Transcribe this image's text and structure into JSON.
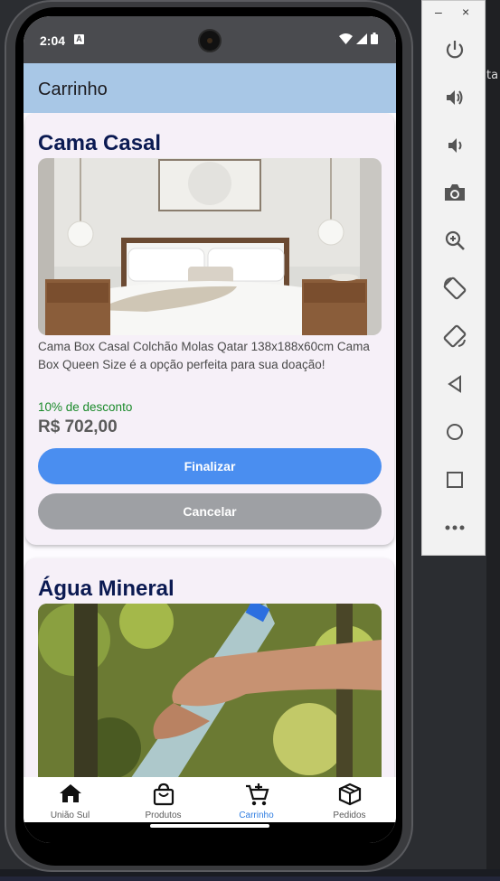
{
  "status_bar": {
    "time": "2:04",
    "notif_badge": "A"
  },
  "app_bar": {
    "title": "Carrinho"
  },
  "cart_items": [
    {
      "name": "Cama Casal",
      "image": "bedroom-photo",
      "description": "Cama Box Casal Colchão Molas Qatar 138x188x60cm Cama Box Queen Size é a opção perfeita para sua doação!",
      "discount": "10% de desconto",
      "price": "R$ 702,00",
      "finalize_label": "Finalizar",
      "cancel_label": "Cancelar"
    },
    {
      "name": "Água Mineral",
      "image": "water-bottle-photo"
    }
  ],
  "bottom_nav": [
    {
      "label": "União Sul",
      "icon": "home-icon",
      "active": false
    },
    {
      "label": "Produtos",
      "icon": "shopping-bag-icon",
      "active": false
    },
    {
      "label": "Carrinho",
      "icon": "cart-add-icon",
      "active": true
    },
    {
      "label": "Pedidos",
      "icon": "package-icon",
      "active": false
    }
  ],
  "emulator_toolbar": {
    "window_controls": [
      "–",
      "×"
    ],
    "buttons": [
      "power-icon",
      "volume-up-icon",
      "volume-down-icon",
      "camera-icon",
      "zoom-icon",
      "rotate-left-icon",
      "rotate-right-icon",
      "back-icon",
      "home-circle-icon",
      "overview-icon",
      "more-icon"
    ]
  },
  "background_snippet": "ta",
  "colors": {
    "app_bar": "#a8c7e6",
    "primary_button": "#4a8ef0",
    "secondary_button": "#9ea0a4",
    "discount_text": "#1a8a2a",
    "title_text": "#0b1a52",
    "active_nav": "#2f7de1"
  }
}
